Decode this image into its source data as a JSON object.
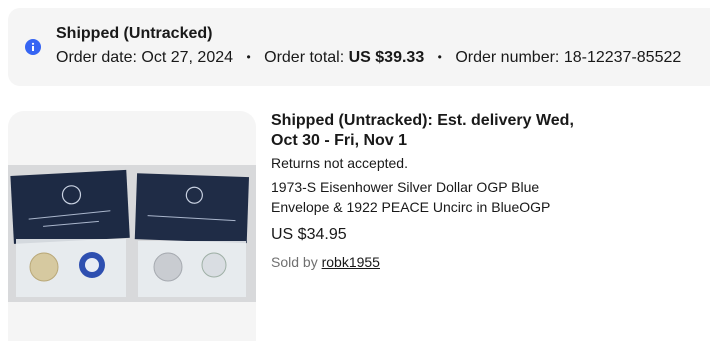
{
  "order": {
    "status_title": "Shipped (Untracked)",
    "date_label": "Order date:",
    "date_value": "Oct 27, 2024",
    "total_label": "Order total:",
    "total_value": "US $39.33",
    "number_label": "Order number:",
    "number_value": "18-12237-85522",
    "separator": "•"
  },
  "item": {
    "delivery": "Shipped (Untracked): Est. delivery Wed, Oct 30 - Fri, Nov 1",
    "returns": "Returns not accepted.",
    "title": "1973-S Eisenhower Silver Dollar OGP Blue Envelope & 1922 PEACE Uncirc in BlueOGP",
    "price": "US $34.95",
    "sold_by_label": "Sold by",
    "seller_name": "robk1955"
  },
  "colors": {
    "info_icon": "#3665f3",
    "card_bg": "#f5f5f5"
  }
}
